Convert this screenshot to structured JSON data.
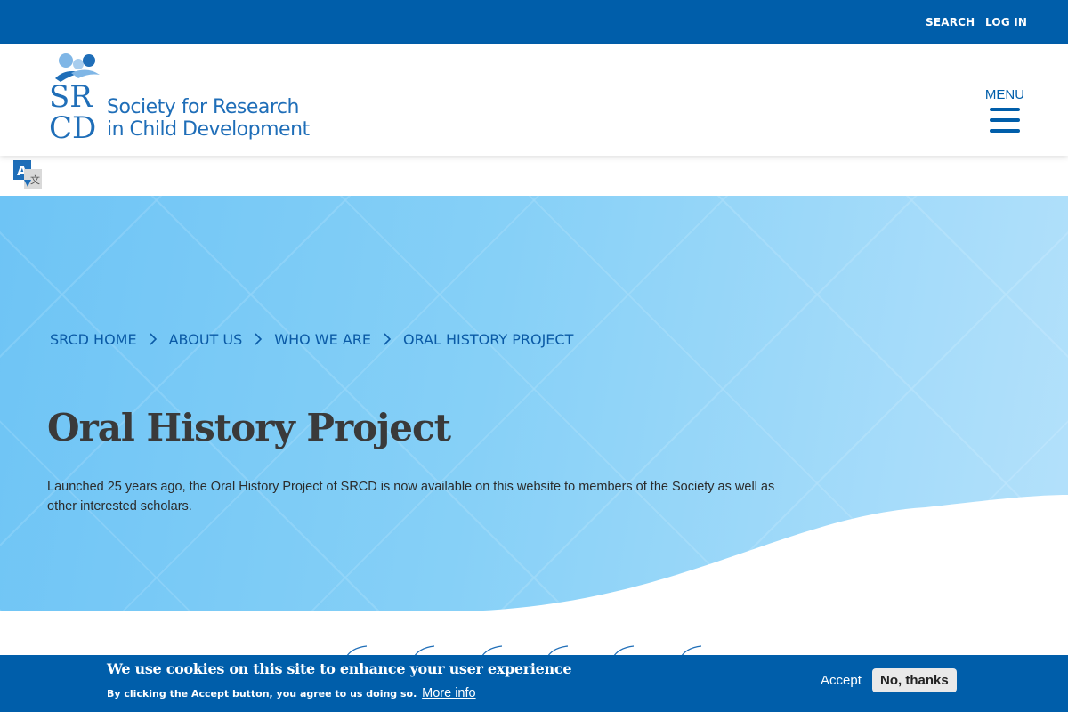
{
  "topbar": {
    "search_label": "SEARCH",
    "login_label": "LOG IN"
  },
  "header": {
    "logo": {
      "monogram_top": "SR",
      "monogram_bottom": "CD",
      "line1": "Society for Research",
      "line2": "in Child Development"
    },
    "menu_label": "MENU"
  },
  "translate": {
    "icon": "translate-icon"
  },
  "breadcrumb": [
    "SRCD HOME",
    "ABOUT US",
    "WHO WE ARE",
    "ORAL HISTORY PROJECT"
  ],
  "hero": {
    "title": "Oral History Project",
    "intro": "Launched 25 years ago, the Oral History Project of SRCD is now available on this website to members of the Society as well as other interested scholars."
  },
  "cookie": {
    "title": "We use cookies on this site to enhance your user experience",
    "text": "By clicking the Accept button, you agree to us doing so.",
    "more_info": "More info",
    "accept_label": "Accept",
    "decline_label": "No, thanks"
  },
  "colors": {
    "brand_blue": "#005eaa",
    "hero_light": "#b4e1fb",
    "hero_mid": "#6ec4f5",
    "title_gray": "#3a3a3a"
  }
}
